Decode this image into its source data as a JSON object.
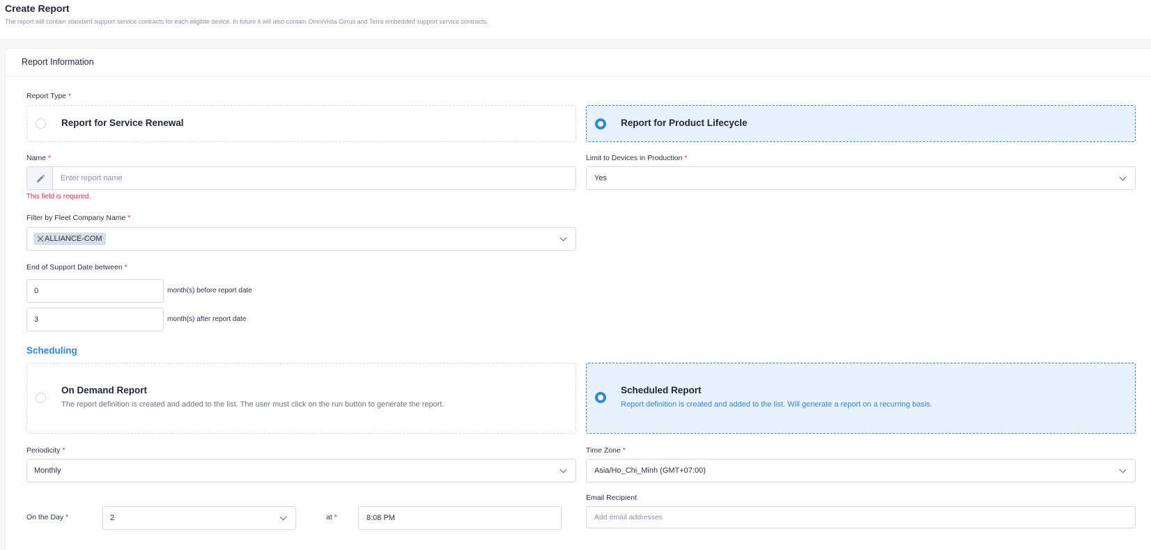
{
  "page": {
    "title": "Create Report",
    "subtitle": "The report will contain standard support service contracts for each eligible device. In future it will also contain OmniVista Cirrus and Terra embedded support service contracts."
  },
  "card": {
    "title": "Report Information"
  },
  "report_type": {
    "label": "Report Type",
    "required": "*",
    "options": [
      {
        "label": "Report for Service Renewal",
        "selected": false
      },
      {
        "label": "Report for Product Lifecycle",
        "selected": true
      }
    ]
  },
  "name": {
    "label": "Name",
    "required": "*",
    "placeholder": "Enter report name",
    "value": "",
    "icon": "pencil-icon",
    "error": "This field is required."
  },
  "limit_devices": {
    "label": "Limit to Devices in Production",
    "required": "*",
    "value": "Yes"
  },
  "fleet_filter": {
    "label": "Filter by Fleet Company Name",
    "required": "*",
    "tags": [
      "ALLIANCE-COM"
    ]
  },
  "end_of_support": {
    "label": "End of Support Date between",
    "required": "*",
    "before_value": "0",
    "before_suffix": "month(s) before report date",
    "after_value": "3",
    "after_suffix": "month(s) after report date"
  },
  "scheduling": {
    "title": "Scheduling",
    "options": [
      {
        "title": "On Demand Report",
        "desc": "The report definition is created and added to the list. The user must click on the run button to generate the report.",
        "selected": false
      },
      {
        "title": "Scheduled Report",
        "desc": "Report definition is created and added to the list. Will generate a report on a recurring basis.",
        "selected": true
      }
    ]
  },
  "periodicity": {
    "label": "Periodicity",
    "required": "*",
    "value": "Monthly"
  },
  "time_zone": {
    "label": "Time Zone",
    "required": "*",
    "value": "Asia/Ho_Chi_Minh (GMT+07:00)"
  },
  "on_the_day": {
    "label": "On the Day",
    "required": "*",
    "value": "2"
  },
  "at": {
    "label": "at",
    "required": "*",
    "value": "8:08 PM"
  },
  "email": {
    "label": "Email Recipient",
    "placeholder": "Add email addresses"
  },
  "colors": {
    "accent": "#2e86e6",
    "error": "#e0284e",
    "selected_bg": "#e8f2fe"
  }
}
